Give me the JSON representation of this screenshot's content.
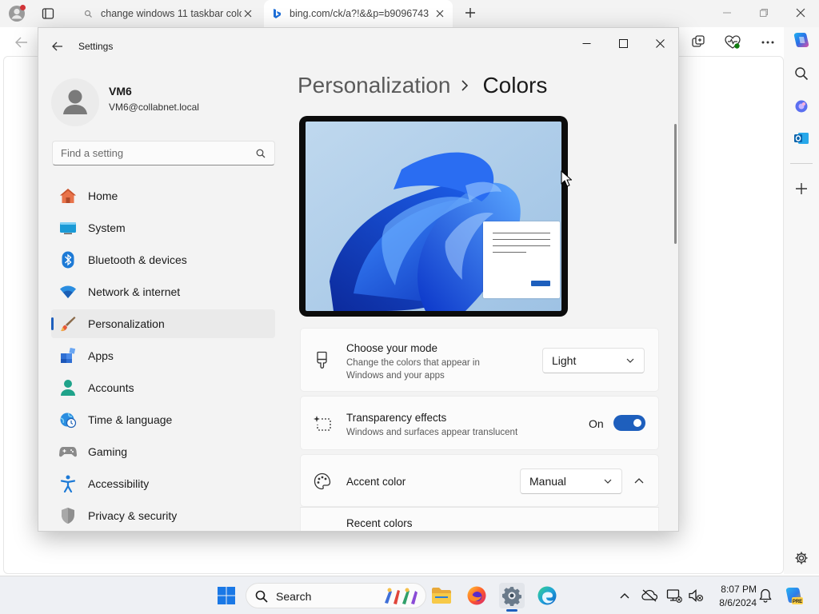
{
  "browser": {
    "tabs": [
      {
        "title": "change windows 11 taskbar colo"
      },
      {
        "title": "bing.com/ck/a?!&&p=b9096743"
      }
    ]
  },
  "settings": {
    "window_title": "Settings",
    "user": {
      "name": "VM6",
      "email": "VM6@collabnet.local"
    },
    "search_placeholder": "Find a setting",
    "nav": [
      {
        "label": "Home",
        "icon": "home-icon"
      },
      {
        "label": "System",
        "icon": "system-icon"
      },
      {
        "label": "Bluetooth & devices",
        "icon": "bluetooth-icon"
      },
      {
        "label": "Network & internet",
        "icon": "wifi-icon"
      },
      {
        "label": "Personalization",
        "icon": "brush-icon",
        "active": true
      },
      {
        "label": "Apps",
        "icon": "apps-icon"
      },
      {
        "label": "Accounts",
        "icon": "accounts-icon"
      },
      {
        "label": "Time & language",
        "icon": "globe-clock-icon"
      },
      {
        "label": "Gaming",
        "icon": "gamepad-icon"
      },
      {
        "label": "Accessibility",
        "icon": "accessibility-icon"
      },
      {
        "label": "Privacy & security",
        "icon": "shield-icon"
      }
    ],
    "breadcrumb": {
      "parent": "Personalization",
      "current": "Colors"
    },
    "mode": {
      "title": "Choose your mode",
      "description": "Change the colors that appear in Windows and your apps",
      "value": "Light"
    },
    "transparency": {
      "title": "Transparency effects",
      "description": "Windows and surfaces appear translucent",
      "state_label": "On",
      "enabled": true
    },
    "accent": {
      "title": "Accent color",
      "value": "Manual"
    },
    "recent_colors_label": "Recent colors"
  },
  "taskbar": {
    "search_label": "Search",
    "clock": {
      "time": "8:07 PM",
      "date": "8/6/2024"
    }
  },
  "colors": {
    "accent": "#1e5fbd"
  }
}
